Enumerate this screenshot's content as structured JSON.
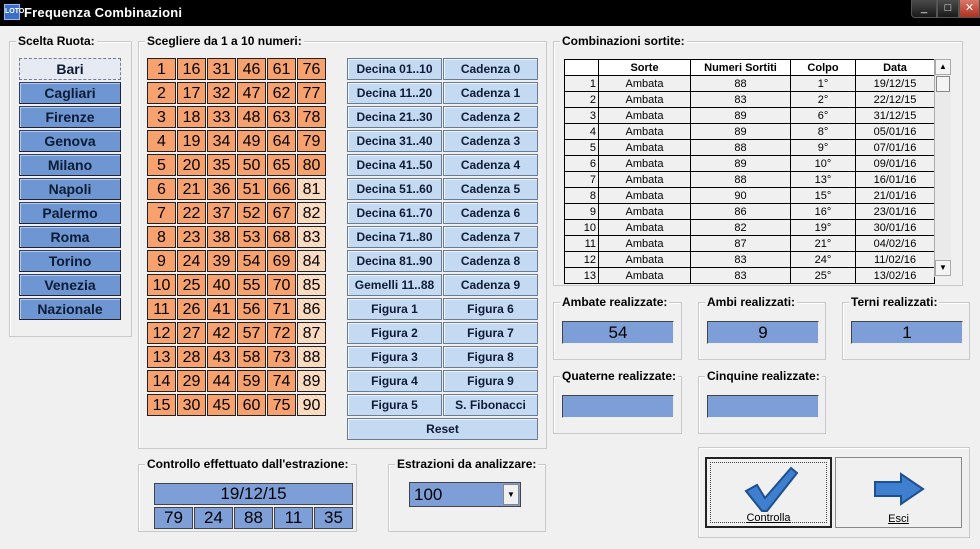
{
  "window": {
    "title": "Frequenza Combinazioni",
    "buttons": {
      "minimize": "_",
      "maximize": "□",
      "close": "✕"
    }
  },
  "scelta_ruota": {
    "label": "Scelta Ruota:",
    "items": [
      "Bari",
      "Cagliari",
      "Firenze",
      "Genova",
      "Milano",
      "Napoli",
      "Palermo",
      "Roma",
      "Torino",
      "Venezia",
      "Nazionale"
    ],
    "selected": "Bari"
  },
  "numeri": {
    "label": "Scegliere da 1 a 10 numeri:",
    "columns": [
      [
        "1",
        "2",
        "3",
        "4",
        "5",
        "6",
        "7",
        "8",
        "9",
        "10",
        "11",
        "12",
        "13",
        "14",
        "15"
      ],
      [
        "16",
        "17",
        "18",
        "19",
        "20",
        "21",
        "22",
        "23",
        "24",
        "25",
        "26",
        "27",
        "28",
        "29",
        "30"
      ],
      [
        "31",
        "32",
        "33",
        "34",
        "35",
        "36",
        "37",
        "38",
        "39",
        "40",
        "41",
        "42",
        "43",
        "44",
        "45"
      ],
      [
        "46",
        "47",
        "48",
        "49",
        "50",
        "51",
        "52",
        "53",
        "54",
        "55",
        "56",
        "57",
        "58",
        "59",
        "60"
      ],
      [
        "61",
        "62",
        "63",
        "64",
        "65",
        "66",
        "67",
        "68",
        "69",
        "70",
        "71",
        "72",
        "73",
        "74",
        "75"
      ],
      [
        "76",
        "77",
        "78",
        "79",
        "80",
        "81",
        "82",
        "83",
        "84",
        "85",
        "86",
        "87",
        "88",
        "89",
        "90"
      ]
    ]
  },
  "decine": [
    "Decina 01..10",
    "Decina 11..20",
    "Decina 21..30",
    "Decina 31..40",
    "Decina 41..50",
    "Decina 51..60",
    "Decina 61..70",
    "Decina 71..80",
    "Decina 81..90",
    "Gemelli 11..88"
  ],
  "cadenze": [
    "Cadenza 0",
    "Cadenza 1",
    "Cadenza 2",
    "Cadenza 3",
    "Cadenza 4",
    "Cadenza 5",
    "Cadenza 6",
    "Cadenza 7",
    "Cadenza 8",
    "Cadenza 9"
  ],
  "figure_left": [
    "Figura 1",
    "Figura 2",
    "Figura 3",
    "Figura 4",
    "Figura 5"
  ],
  "figure_right": [
    "Figura 6",
    "Figura 7",
    "Figura 8",
    "Figura 9",
    "S. Fibonacci"
  ],
  "reset_label": "Reset",
  "combinazioni": {
    "label": "Combinazioni sortite:",
    "headers": [
      "",
      "Sorte",
      "Numeri Sortiti",
      "Colpo",
      "Data"
    ],
    "rows": [
      [
        "1",
        "Ambata",
        "88",
        "1°",
        "19/12/15"
      ],
      [
        "2",
        "Ambata",
        "83",
        "2°",
        "22/12/15"
      ],
      [
        "3",
        "Ambata",
        "89",
        "6°",
        "31/12/15"
      ],
      [
        "4",
        "Ambata",
        "89",
        "8°",
        "05/01/16"
      ],
      [
        "5",
        "Ambata",
        "88",
        "9°",
        "07/01/16"
      ],
      [
        "6",
        "Ambata",
        "89",
        "10°",
        "09/01/16"
      ],
      [
        "7",
        "Ambata",
        "88",
        "13°",
        "16/01/16"
      ],
      [
        "8",
        "Ambata",
        "90",
        "15°",
        "21/01/16"
      ],
      [
        "9",
        "Ambata",
        "86",
        "16°",
        "23/01/16"
      ],
      [
        "10",
        "Ambata",
        "82",
        "19°",
        "30/01/16"
      ],
      [
        "11",
        "Ambata",
        "87",
        "21°",
        "04/02/16"
      ],
      [
        "12",
        "Ambata",
        "83",
        "24°",
        "11/02/16"
      ],
      [
        "13",
        "Ambata",
        "83",
        "25°",
        "13/02/16"
      ]
    ]
  },
  "risultati": {
    "ambate": {
      "label": "Ambate realizzate:",
      "value": "54"
    },
    "ambi": {
      "label": "Ambi realizzati:",
      "value": "9"
    },
    "terni": {
      "label": "Terni realizzati:",
      "value": "1"
    },
    "quaterne": {
      "label": "Quaterne realizzate:",
      "value": ""
    },
    "cinquine": {
      "label": "Cinquine realizzate:",
      "value": ""
    }
  },
  "controllo": {
    "label": "Controllo effettuato dall'estrazione:",
    "date": "19/12/15",
    "numbers": [
      "79",
      "24",
      "88",
      "11",
      "35"
    ]
  },
  "estrazioni": {
    "label": "Estrazioni da analizzare:",
    "value": "100"
  },
  "actions": {
    "controlla": "Controlla",
    "esci": "Esci"
  },
  "colors": {
    "number_cell": "#f7a26e",
    "ruota_button": "#6e96d2",
    "function_button": "#c4daf2",
    "value_box": "#7d9ed6"
  }
}
